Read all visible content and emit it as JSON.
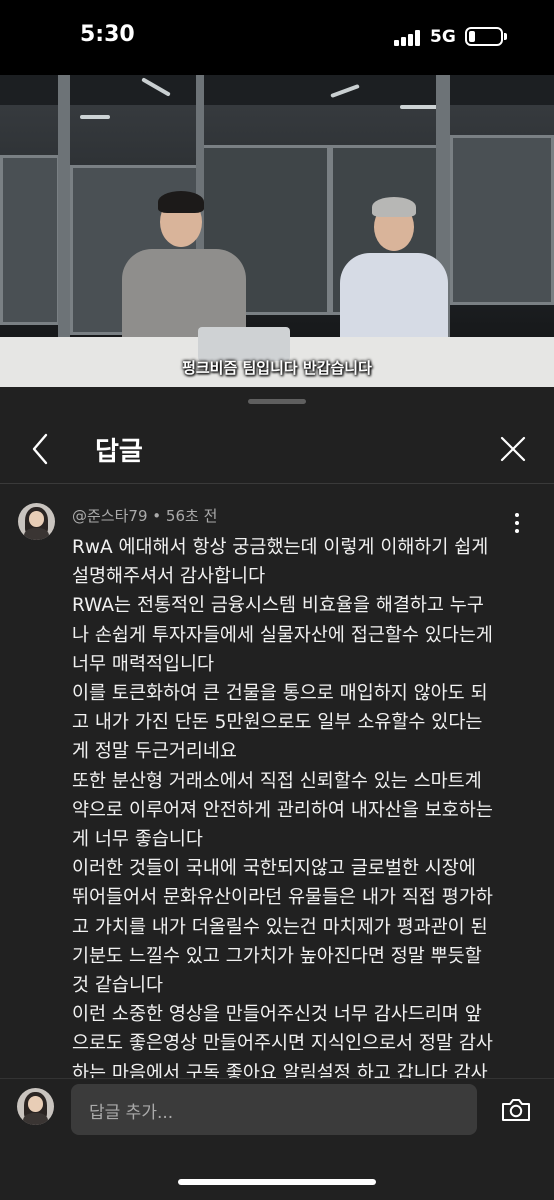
{
  "status_bar": {
    "time": "5:30",
    "network": "5G",
    "battery_level": 0.2
  },
  "video": {
    "subtitle": "펑크비즘 팀입니다 반갑습니다"
  },
  "sheet": {
    "title": "답글"
  },
  "comment": {
    "author": "@준스타79",
    "separator": "•",
    "time": "56초 전",
    "lines": [
      "RwA 에대해서 항상 궁금했는데 이렇게 이해하기 쉽게",
      "설명해주셔서 감사합니다",
      "RWA는 전통적인 금융시스템 비효율을 해결하고 누구",
      "나 손쉽게 투자자들에세 실물자산에 접근할수 있다는게",
      "너무 매력적입니다",
      "이를 토큰화하여 큰 건물을 통으로 매입하지 않아도 되",
      "고 내가 가진 단돈 5만원으로도 일부 소유할수 있다는",
      "게 정말 두근거리네요",
      "또한 분산형 거래소에서 직접 신뢰할수 있는 스마트계",
      "약으로 이루어져 안전하게 관리하여 내자산을 보호하는",
      "게 너무 좋습니다",
      "이러한 것들이 국내에 국한되지않고 글로벌한 시장에",
      "뛰어들어서 문화유산이라던 유물들은 내가 직접 평가하",
      "고 가치를 내가 더올릴수 있는건 마치제가 평과관이 된",
      "기분도 느낄수 있고 그가치가 높아진다면 정말 뿌듯할",
      "것 같습니다",
      "이런 소중한 영상을 만들어주신것 너무 감사드리며 앞",
      "으로도 좋은영상 만들어주시면 지식인으로서 정말 감사",
      "하는 마음에서 구독 좋아요 알림설정 하고 갑니다 감사"
    ]
  },
  "reply": {
    "placeholder": "답글 추가..."
  },
  "icons": {
    "back": "chevron-left-icon",
    "close": "close-icon",
    "more": "more-vertical-icon",
    "camera": "camera-icon"
  },
  "colors": {
    "sheet_bg": "#212121",
    "input_bg": "#3b3b3b",
    "meta_text": "#aaaaaa"
  }
}
